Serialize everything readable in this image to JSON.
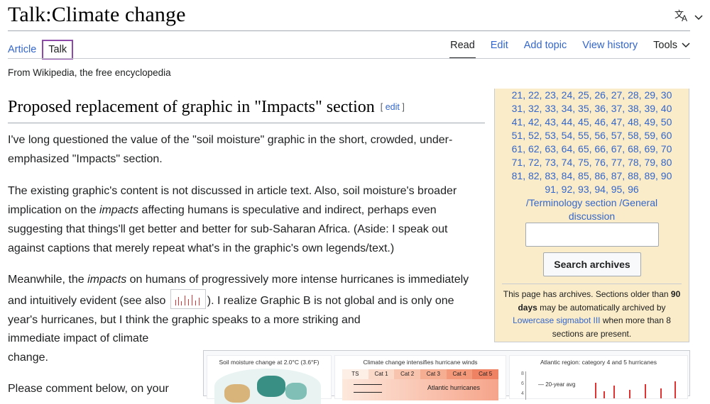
{
  "page": {
    "title": "Talk:Climate change",
    "language_icon": "translate-icon",
    "tagline": "From Wikipedia, the free encyclopedia"
  },
  "tabs": {
    "article": "Article",
    "talk": "Talk",
    "read": "Read",
    "edit": "Edit",
    "add_topic": "Add topic",
    "view_history": "View history",
    "tools": "Tools"
  },
  "section": {
    "heading": "Proposed replacement of graphic in \"Impacts\" section",
    "edit_open": "[ ",
    "edit_label": "edit",
    "edit_close": " ]"
  },
  "body": {
    "p1": "I've long questioned the value of the \"soil moisture\" graphic in the short, crowded, under-emphasized \"Impacts\" section.",
    "p2_a": "The existing graphic's content is not discussed in article text. Also, soil moisture's broader implication on the ",
    "p2_em": "impacts",
    "p2_b": " affecting humans is speculative and indirect, perhaps even suggesting that things'll get better and better for sub-Saharan Africa. (Aside: I speak out against captions that merely repeat what's in the graphic's own legends/text.)",
    "p3_a": "Meanwhile, the ",
    "p3_em": "impacts",
    "p3_b": " on humans of progressively more intense hurricanes is immediately and intuitively evident (see also ",
    "p3_c": "). I realize Graphic B is not global and is only one year's hurricanes, but I think the graphic speaks to a more striking and",
    "p4": "immediate impact of climate",
    "p5": "change.",
    "p6": "Please comment below, on your"
  },
  "archives": {
    "lines": [
      "21, 22, 23, 24, 25, 26, 27, 28, 29, 30",
      "31, 32, 33, 34, 35, 36, 37, 38, 39, 40",
      "41, 42, 43, 44, 45, 46, 47, 48, 49, 50",
      "51, 52, 53, 54, 55, 56, 57, 58, 59, 60",
      "61, 62, 63, 64, 65, 66, 67, 68, 69, 70",
      "71, 72, 73, 74, 75, 76, 77, 78, 79, 80",
      "81, 82, 83, 84, 85, 86, 87, 88, 89, 90",
      "91, 92, 93, 94, 95, 96",
      "/Terminology section /General",
      "discussion"
    ],
    "search_value": "",
    "search_button": "Search archives",
    "note_a": "This page has archives. Sections older than ",
    "note_bold": "90 days",
    "note_b": " may be automatically archived by ",
    "note_link": "Lowercase sigmabot III",
    "note_c": " when more than 8 sections are present."
  },
  "gallery": {
    "g1_caption": "Soil moisture change at 2.0°C (3.6°F)",
    "g2_caption": "Climate change intensifies hurricane winds",
    "g2_cats": [
      "TS",
      "Cat 1",
      "Cat 2",
      "Cat 3",
      "Cat 4",
      "Cat 5"
    ],
    "g2_label": "Atlantic hurricanes",
    "g3_caption": "Atlantic region: category 4 and 5 hurricanes",
    "g3_legend": "— 20-year avg",
    "g3_ticks": [
      "8",
      "6",
      "4"
    ]
  },
  "colors": {
    "link": "#3366cc",
    "archive_bg": "#faecc8",
    "talk_tab_border": "#8e4aa8"
  }
}
